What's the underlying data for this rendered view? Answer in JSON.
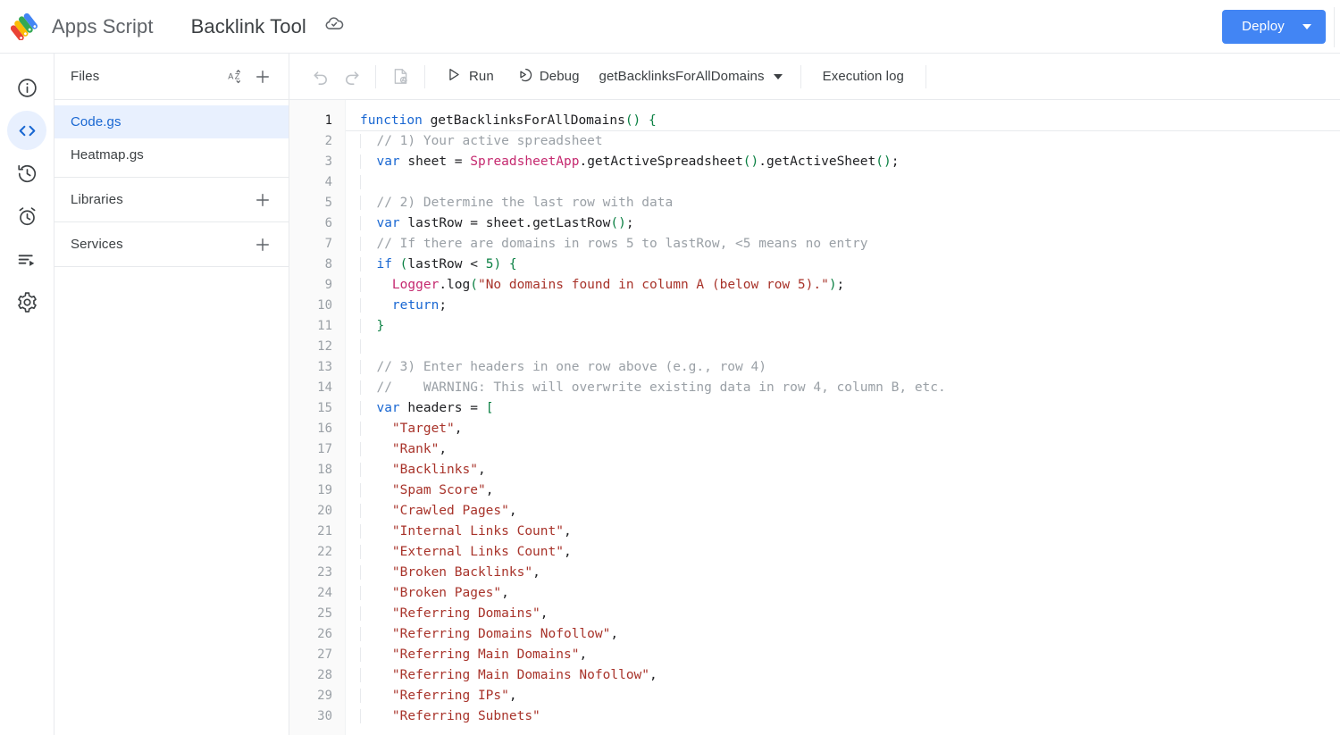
{
  "topbar": {
    "logo_icon": "apps-script-logo",
    "brand": "Apps Script",
    "project_title": "Backlink Tool",
    "save_status_icon": "cloud-done-icon",
    "deploy_label": "Deploy",
    "deploy_color": "#4285f4"
  },
  "rail": {
    "items": [
      {
        "name": "overview",
        "icon": "info-icon",
        "active": false
      },
      {
        "name": "editor",
        "icon": "code-brackets-icon",
        "active": true
      },
      {
        "name": "project-history",
        "icon": "history-icon",
        "active": false
      },
      {
        "name": "triggers",
        "icon": "alarm-clock-icon",
        "active": false
      },
      {
        "name": "executions",
        "icon": "executions-list-icon",
        "active": false
      },
      {
        "name": "project-settings",
        "icon": "gear-icon",
        "active": false
      }
    ]
  },
  "files_panel": {
    "files_header": "Files",
    "sort_icon": "sort-az-icon",
    "add_file_icon": "plus-icon",
    "files": [
      {
        "label": "Code.gs",
        "selected": true
      },
      {
        "label": "Heatmap.gs",
        "selected": false
      }
    ],
    "libraries_header": "Libraries",
    "libraries_add_icon": "plus-icon",
    "services_header": "Services",
    "services_add_icon": "plus-icon"
  },
  "editor_toolbar": {
    "undo_icon": "undo-icon",
    "redo_icon": "redo-icon",
    "save_project_icon": "save-to-drive-icon",
    "run_label": "Run",
    "run_icon": "play-icon",
    "debug_label": "Debug",
    "debug_icon": "debug-icon",
    "function_selected": "getBacklinksForAllDomains",
    "function_caret_icon": "chevron-down-icon",
    "execution_log_label": "Execution log"
  },
  "code": {
    "active_line": 1,
    "first_line": 1,
    "last_line": 30,
    "lines": [
      {
        "n": 1,
        "tokens": [
          {
            "t": "function",
            "c": "kw"
          },
          {
            "t": " ",
            "c": "pnc"
          },
          {
            "t": "getBacklinksForAllDomains",
            "c": "fn"
          },
          {
            "t": "()",
            "c": "brc"
          },
          {
            "t": " ",
            "c": "pnc"
          },
          {
            "t": "{",
            "c": "brc"
          }
        ]
      },
      {
        "n": 2,
        "indent": 1,
        "tokens": [
          {
            "t": "// 1) Your active spreadsheet",
            "c": "cmt"
          }
        ]
      },
      {
        "n": 3,
        "indent": 1,
        "tokens": [
          {
            "t": "var",
            "c": "kw"
          },
          {
            "t": " sheet = ",
            "c": "pnc"
          },
          {
            "t": "SpreadsheetApp",
            "c": "cls"
          },
          {
            "t": ".getActiveSpreadsheet",
            "c": "pnc"
          },
          {
            "t": "()",
            "c": "brc"
          },
          {
            "t": ".getActiveSheet",
            "c": "pnc"
          },
          {
            "t": "()",
            "c": "brc"
          },
          {
            "t": ";",
            "c": "pnc"
          }
        ]
      },
      {
        "n": 4,
        "indent": 1,
        "tokens": []
      },
      {
        "n": 5,
        "indent": 1,
        "tokens": [
          {
            "t": "// 2) Determine the last row with data",
            "c": "cmt"
          }
        ]
      },
      {
        "n": 6,
        "indent": 1,
        "tokens": [
          {
            "t": "var",
            "c": "kw"
          },
          {
            "t": " lastRow = sheet.getLastRow",
            "c": "pnc"
          },
          {
            "t": "()",
            "c": "brc"
          },
          {
            "t": ";",
            "c": "pnc"
          }
        ]
      },
      {
        "n": 7,
        "indent": 1,
        "tokens": [
          {
            "t": "// If there are domains in rows 5 to lastRow, <5 means no entry",
            "c": "cmt"
          }
        ]
      },
      {
        "n": 8,
        "indent": 1,
        "tokens": [
          {
            "t": "if",
            "c": "kw"
          },
          {
            "t": " ",
            "c": "pnc"
          },
          {
            "t": "(",
            "c": "brc"
          },
          {
            "t": "lastRow < ",
            "c": "pnc"
          },
          {
            "t": "5",
            "c": "num"
          },
          {
            "t": ")",
            "c": "brc"
          },
          {
            "t": " ",
            "c": "pnc"
          },
          {
            "t": "{",
            "c": "brc"
          }
        ]
      },
      {
        "n": 9,
        "indent": 2,
        "tokens": [
          {
            "t": "Logger",
            "c": "cls"
          },
          {
            "t": ".log",
            "c": "pnc"
          },
          {
            "t": "(",
            "c": "brc"
          },
          {
            "t": "\"No domains found in column A (below row 5).\"",
            "c": "str"
          },
          {
            "t": ")",
            "c": "brc"
          },
          {
            "t": ";",
            "c": "pnc"
          }
        ]
      },
      {
        "n": 10,
        "indent": 2,
        "tokens": [
          {
            "t": "return",
            "c": "kw"
          },
          {
            "t": ";",
            "c": "pnc"
          }
        ]
      },
      {
        "n": 11,
        "indent": 1,
        "tokens": [
          {
            "t": "}",
            "c": "brc"
          }
        ]
      },
      {
        "n": 12,
        "indent": 1,
        "tokens": []
      },
      {
        "n": 13,
        "indent": 1,
        "tokens": [
          {
            "t": "// 3) Enter headers in one row above (e.g., row 4)",
            "c": "cmt"
          }
        ]
      },
      {
        "n": 14,
        "indent": 1,
        "tokens": [
          {
            "t": "//    WARNING: This will overwrite existing data in row 4, column B, etc.",
            "c": "cmt"
          }
        ]
      },
      {
        "n": 15,
        "indent": 1,
        "tokens": [
          {
            "t": "var",
            "c": "kw"
          },
          {
            "t": " headers = ",
            "c": "pnc"
          },
          {
            "t": "[",
            "c": "brc"
          }
        ]
      },
      {
        "n": 16,
        "indent": 2,
        "tokens": [
          {
            "t": "\"Target\"",
            "c": "str"
          },
          {
            "t": ",",
            "c": "pnc"
          }
        ]
      },
      {
        "n": 17,
        "indent": 2,
        "tokens": [
          {
            "t": "\"Rank\"",
            "c": "str"
          },
          {
            "t": ",",
            "c": "pnc"
          }
        ]
      },
      {
        "n": 18,
        "indent": 2,
        "tokens": [
          {
            "t": "\"Backlinks\"",
            "c": "str"
          },
          {
            "t": ",",
            "c": "pnc"
          }
        ]
      },
      {
        "n": 19,
        "indent": 2,
        "tokens": [
          {
            "t": "\"Spam Score\"",
            "c": "str"
          },
          {
            "t": ",",
            "c": "pnc"
          }
        ]
      },
      {
        "n": 20,
        "indent": 2,
        "tokens": [
          {
            "t": "\"Crawled Pages\"",
            "c": "str"
          },
          {
            "t": ",",
            "c": "pnc"
          }
        ]
      },
      {
        "n": 21,
        "indent": 2,
        "tokens": [
          {
            "t": "\"Internal Links Count\"",
            "c": "str"
          },
          {
            "t": ",",
            "c": "pnc"
          }
        ]
      },
      {
        "n": 22,
        "indent": 2,
        "tokens": [
          {
            "t": "\"External Links Count\"",
            "c": "str"
          },
          {
            "t": ",",
            "c": "pnc"
          }
        ]
      },
      {
        "n": 23,
        "indent": 2,
        "tokens": [
          {
            "t": "\"Broken Backlinks\"",
            "c": "str"
          },
          {
            "t": ",",
            "c": "pnc"
          }
        ]
      },
      {
        "n": 24,
        "indent": 2,
        "tokens": [
          {
            "t": "\"Broken Pages\"",
            "c": "str"
          },
          {
            "t": ",",
            "c": "pnc"
          }
        ]
      },
      {
        "n": 25,
        "indent": 2,
        "tokens": [
          {
            "t": "\"Referring Domains\"",
            "c": "str"
          },
          {
            "t": ",",
            "c": "pnc"
          }
        ]
      },
      {
        "n": 26,
        "indent": 2,
        "tokens": [
          {
            "t": "\"Referring Domains Nofollow\"",
            "c": "str"
          },
          {
            "t": ",",
            "c": "pnc"
          }
        ]
      },
      {
        "n": 27,
        "indent": 2,
        "tokens": [
          {
            "t": "\"Referring Main Domains\"",
            "c": "str"
          },
          {
            "t": ",",
            "c": "pnc"
          }
        ]
      },
      {
        "n": 28,
        "indent": 2,
        "tokens": [
          {
            "t": "\"Referring Main Domains Nofollow\"",
            "c": "str"
          },
          {
            "t": ",",
            "c": "pnc"
          }
        ]
      },
      {
        "n": 29,
        "indent": 2,
        "tokens": [
          {
            "t": "\"Referring IPs\"",
            "c": "str"
          },
          {
            "t": ",",
            "c": "pnc"
          }
        ]
      },
      {
        "n": 30,
        "indent": 2,
        "tokens": [
          {
            "t": "\"Referring Subnets\"",
            "c": "str"
          }
        ]
      }
    ]
  }
}
